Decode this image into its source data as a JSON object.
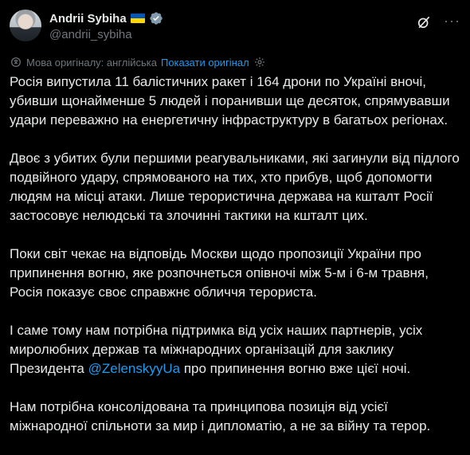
{
  "author": {
    "name": "Andrii Sybiha",
    "handle": "@andrii_sybiha"
  },
  "translation": {
    "source_text": "Мова оригіналу: англійська",
    "show_original": "Показати оригінал"
  },
  "paragraphs": [
    {
      "text": "Росія випустила 11 балістичних ракет і 164 дрони по Україні вночі, убивши щонайменше 5 людей і поранивши ще десяток, спрямувавши удари переважно на енергетичну інфраструктуру в багатьох регіонах."
    },
    {
      "text": "Двоє з убитих були першими реагувальниками, які загинули від підлого подвійного удару, спрямованого на тих, хто прибув, щоб допомогти людям на місці атаки. Лише терористична держава на кшталт Росії застосовує нелюдські та злочинні тактики на кшталт цих."
    },
    {
      "text": "Поки світ чекає на відповідь Москви щодо пропозиції України про припинення вогню, яке розпочнеться опівночі між 5-м і 6-м травня, Росія показує своє справжнє обличчя терориста."
    },
    {
      "before": "І саме тому нам потрібна підтримка від усіх наших партнерів, усіх миролюбних держав та міжнародних організацій для заклику Президента ",
      "mention": "@ZelenskyyUa",
      "after": " про припинення вогню вже цієї ночі."
    },
    {
      "text": "Нам потрібна консолідована та принципова позиція від усієї міжнародної спільноти за мир і дипломатію, а не за війну та терор."
    }
  ],
  "icons": {
    "verified": "verified-badge-icon",
    "grok": "grok-icon",
    "more": "more-options-icon",
    "translate": "translate-icon",
    "settings": "settings-gear-icon"
  },
  "colors": {
    "background": "#000000",
    "text": "#e7e9ea",
    "muted": "#71767b",
    "accent": "#1d9bf0"
  }
}
